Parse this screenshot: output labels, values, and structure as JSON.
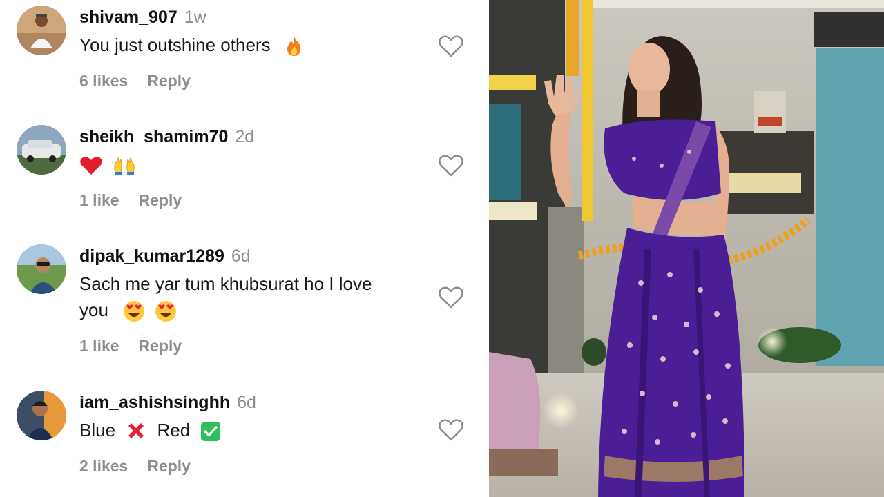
{
  "comments": [
    {
      "username": "shivam_907",
      "time": "1w",
      "text": "You just outshine others",
      "emojis": [
        "fire-emoji"
      ],
      "likes": "6 likes",
      "reply_label": "Reply"
    },
    {
      "username": "sheikh_shamim70",
      "time": "2d",
      "text": "",
      "emojis": [
        "red-heart-emoji",
        "raising-hands-emoji"
      ],
      "likes": "1 like",
      "reply_label": "Reply"
    },
    {
      "username": "dipak_kumar1289",
      "time": "6d",
      "text": "Sach me yar tum khubsurat ho I love you",
      "emojis": [
        "heart-eyes-emoji",
        "heart-eyes-emoji"
      ],
      "likes": "1 like",
      "reply_label": "Reply"
    },
    {
      "username": "iam_ashishsinghh",
      "time": "6d",
      "text_part1": "Blue",
      "text_part2": "Red",
      "emojis": [
        "cross-mark-emoji",
        "check-mark-button-emoji"
      ],
      "likes": "2 likes",
      "reply_label": "Reply"
    }
  ],
  "icons": {
    "like": "heart-outline-icon"
  },
  "colors": {
    "username": "#111111",
    "muted": "#8e8e8e",
    "saree": "#4a1f96"
  }
}
